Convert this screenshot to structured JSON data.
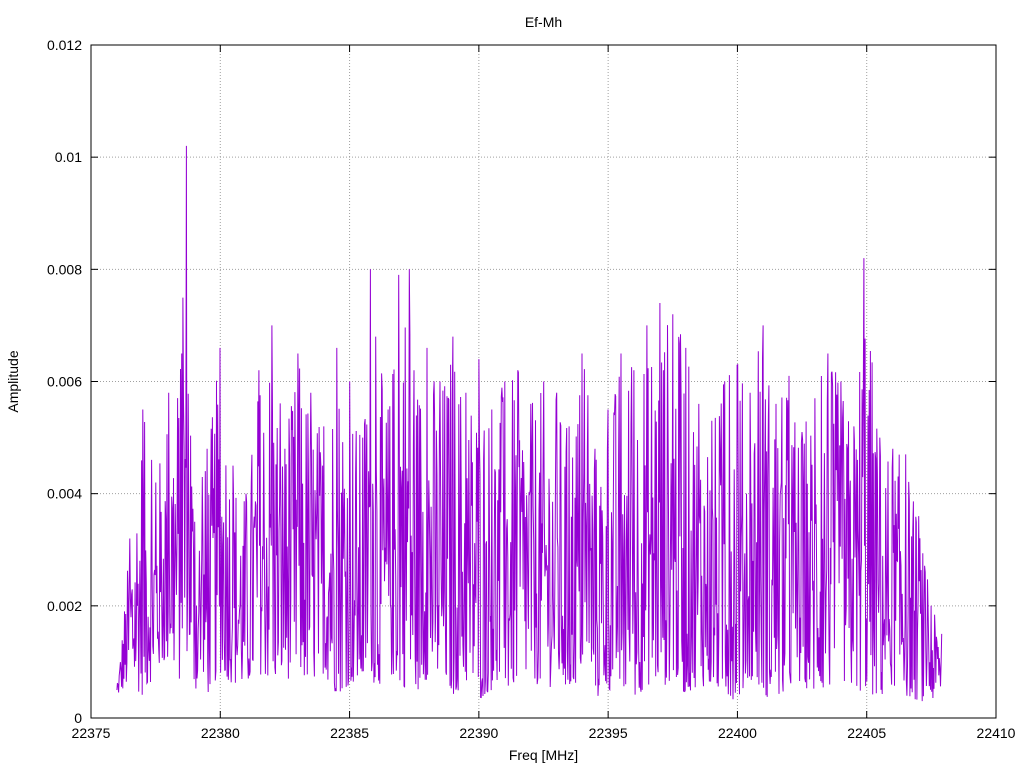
{
  "chart_data": {
    "type": "line",
    "title": "Ef-Mh",
    "xlabel": "Freq [MHz]",
    "ylabel": "Amplitude",
    "xlim": [
      22375,
      22410
    ],
    "ylim": [
      0,
      0.012
    ],
    "xticks": [
      22375,
      22380,
      22385,
      22390,
      22395,
      22400,
      22405,
      22410
    ],
    "xtick_labels": [
      "22375",
      "22380",
      "22385",
      "22390",
      "22395",
      "22400",
      "22405",
      "22410"
    ],
    "yticks": [
      0,
      0.002,
      0.004,
      0.006,
      0.008,
      0.01,
      0.012
    ],
    "ytick_labels": [
      "0",
      "0.002",
      "0.004",
      "0.006",
      "0.008",
      "0.01",
      "0.012"
    ],
    "grid": true,
    "legend": "none",
    "colors": {
      "series": "#9400d3",
      "grid": "#a0a0a0",
      "axis": "#000000"
    },
    "series": [
      {
        "x": [
          22376.0,
          22376.5,
          22377.0,
          22377.5,
          22378.0,
          22378.5,
          22378.7,
          22379.0,
          22379.5,
          22380.0,
          22380.5,
          22381.0,
          22381.5,
          22382.0,
          22382.5,
          22383.0,
          22383.5,
          22384.0,
          22384.5,
          22385.0,
          22385.5,
          22385.8,
          22386.0,
          22386.5,
          22386.9,
          22387.3,
          22387.5,
          22388.0,
          22388.5,
          22389.0,
          22389.5,
          22390.0,
          22390.5,
          22391.0,
          22391.5,
          22392.0,
          22392.5,
          22393.0,
          22393.5,
          22394.0,
          22394.5,
          22395.0,
          22395.5,
          22396.0,
          22396.5,
          22397.0,
          22397.5,
          22398.0,
          22398.5,
          22399.0,
          22399.5,
          22400.0,
          22400.5,
          22401.0,
          22401.5,
          22402.0,
          22402.5,
          22403.0,
          22403.5,
          22404.0,
          22404.5,
          22404.9,
          22405.5,
          22406.0,
          22406.5,
          22407.0,
          22407.5,
          22407.9
        ],
        "y": [
          0.0005,
          0.0032,
          0.0055,
          0.0042,
          0.0058,
          0.0065,
          0.0102,
          0.0035,
          0.0048,
          0.0066,
          0.0045,
          0.004,
          0.0062,
          0.007,
          0.0048,
          0.0065,
          0.0058,
          0.0052,
          0.0066,
          0.006,
          0.005,
          0.008,
          0.0068,
          0.0055,
          0.0079,
          0.008,
          0.0062,
          0.0066,
          0.006,
          0.0068,
          0.0058,
          0.0064,
          0.0055,
          0.006,
          0.0062,
          0.0056,
          0.006,
          0.0058,
          0.0052,
          0.0065,
          0.0048,
          0.0055,
          0.0065,
          0.0062,
          0.007,
          0.0074,
          0.0072,
          0.0066,
          0.0056,
          0.0053,
          0.006,
          0.0063,
          0.0058,
          0.007,
          0.0056,
          0.0061,
          0.0051,
          0.0057,
          0.0065,
          0.006,
          0.0052,
          0.0082,
          0.005,
          0.0048,
          0.0047,
          0.0036,
          0.002,
          0.0015
        ],
        "minima": [
          0.0004,
          0.0006,
          0.0004,
          0.0008,
          0.001,
          0.0006,
          0.0012,
          0.0005,
          0.0004,
          0.0008,
          0.0006,
          0.0005,
          0.0008,
          0.0006,
          0.0007,
          0.0007,
          0.0006,
          0.0008,
          0.0004,
          0.0006,
          0.0005,
          0.0009,
          0.0005,
          0.0008,
          0.0006,
          0.0005,
          0.0004,
          0.0007,
          0.0005,
          0.0004,
          0.0006,
          0.0003,
          0.0005,
          0.0004,
          0.0006,
          0.0007,
          0.0005,
          0.0006,
          0.0004,
          0.0008,
          0.0003,
          0.0005,
          0.0004,
          0.0003,
          0.0006,
          0.0005,
          0.0007,
          0.0004,
          0.0006,
          0.0005,
          0.0004,
          0.0003,
          0.0007,
          0.0004,
          0.0003,
          0.0005,
          0.0006,
          0.0004,
          0.0005,
          0.0006,
          0.0004,
          0.0005,
          0.0003,
          0.0006,
          0.0004,
          0.0003,
          0.0003,
          0.0005
        ]
      }
    ]
  }
}
